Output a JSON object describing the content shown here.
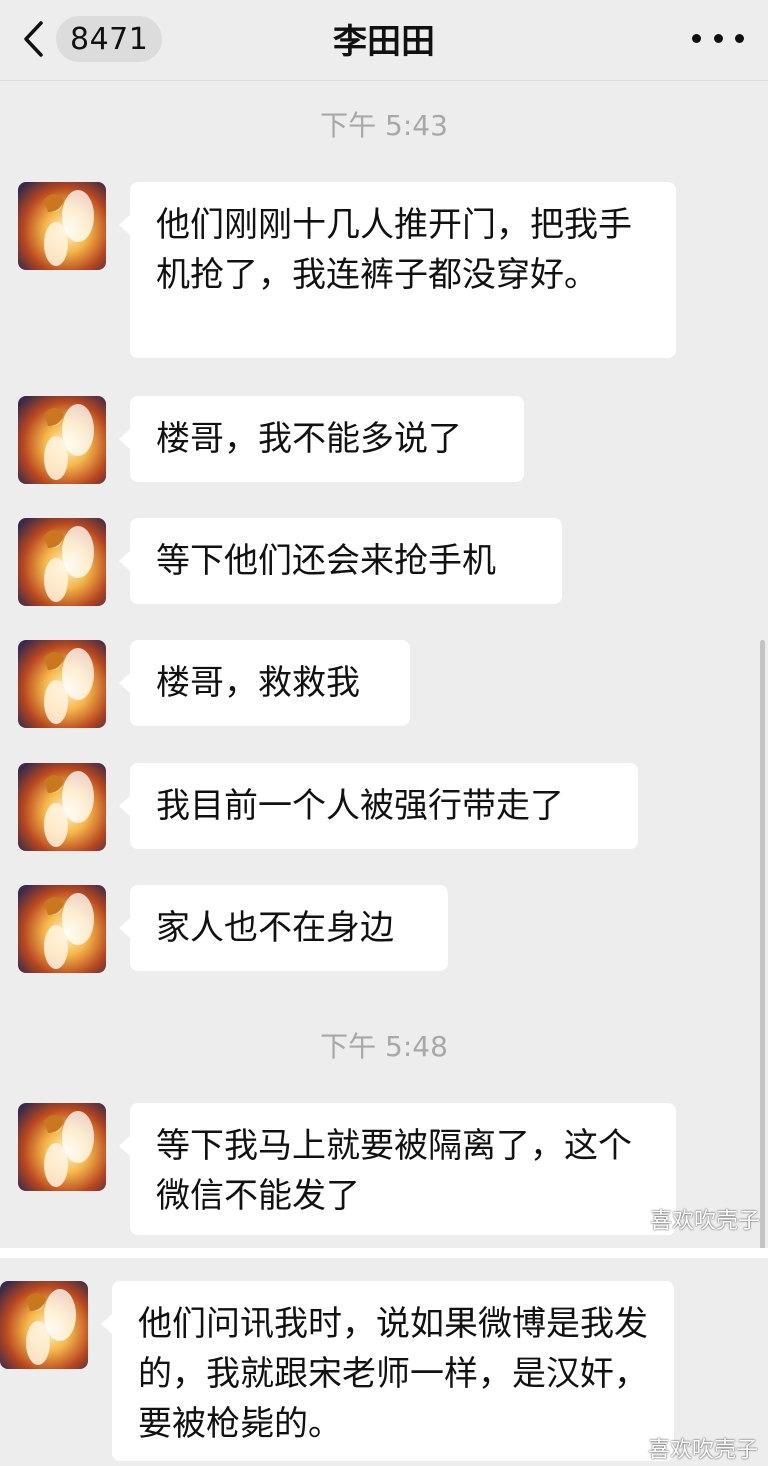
{
  "header": {
    "back_icon": "chevron-left-icon",
    "unread_count": "8471",
    "title": "李田田",
    "more_icon": "more-horizontal-icon"
  },
  "timestamps": [
    "下午 5:43",
    "下午 5:48"
  ],
  "messages": [
    {
      "text": "他们刚刚十几人推开门，把我手机抢了，我连裤子都没穿好。"
    },
    {
      "text": "楼哥，我不能多说了"
    },
    {
      "text": "等下他们还会来抢手机"
    },
    {
      "text": "楼哥，救救我"
    },
    {
      "text": "我目前一个人被强行带走了"
    },
    {
      "text": "家人也不在身边"
    },
    {
      "text": "等下我马上就要被隔离了，这个微信不能发了"
    },
    {
      "text": "他们问讯我时，说如果微博是我发的，我就跟宋老师一样，是汉奸，要被枪毙的。"
    }
  ],
  "watermark": {
    "text": "喜欢吹壳子",
    "icon": "wechat-logo-icon"
  },
  "colors": {
    "background": "#ededed",
    "bubble": "#ffffff",
    "timestamp": "#a8a8a8"
  }
}
